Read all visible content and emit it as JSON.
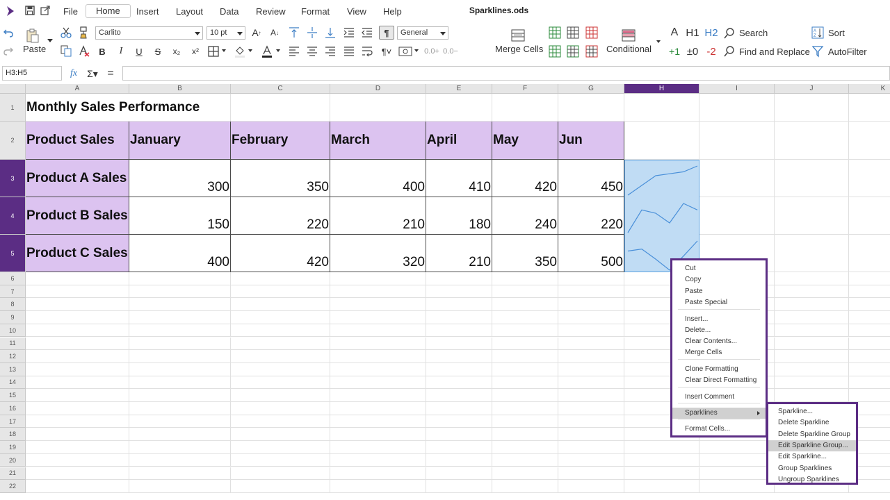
{
  "document": {
    "title": "Sparklines.ods"
  },
  "menubar": {
    "items": [
      "File",
      "Home",
      "Insert",
      "Layout",
      "Data",
      "Review",
      "Format",
      "View",
      "Help"
    ],
    "active": "Home"
  },
  "ribbon": {
    "paste_label": "Paste",
    "font_name": "Carlito",
    "font_size": "10 pt",
    "number_format": "General",
    "merge_cells_label": "Merge Cells",
    "conditional_label": "Conditional",
    "search_label": "Search",
    "find_replace_label": "Find and Replace",
    "sort_label": "Sort",
    "autofilter_label": "AutoFilter",
    "bold": "B",
    "italic": "I",
    "underline": "U",
    "strike": "S",
    "subscript": "x₂",
    "superscript": "x²",
    "heading_a": "A",
    "heading_h1": "H1",
    "heading_h2": "H2",
    "inc_1": "+1",
    "inc_0": "±0",
    "dec_2": "-2",
    "add_decimal": "0.0+",
    "del_decimal": "0.0−"
  },
  "formulabar": {
    "namebox": "H3:H5",
    "formula": ""
  },
  "sheet": {
    "columns": [
      "A",
      "B",
      "C",
      "D",
      "E",
      "F",
      "G",
      "H",
      "I",
      "J",
      "K"
    ],
    "selected_column": "H",
    "rows": [
      "1",
      "2",
      "3",
      "4",
      "5",
      "6",
      "7",
      "8",
      "9",
      "10",
      "11",
      "12",
      "13",
      "14",
      "15",
      "16",
      "17",
      "18",
      "19",
      "20",
      "21",
      "22"
    ],
    "selected_rows": [
      "3",
      "4",
      "5"
    ],
    "title": "Monthly Sales Performance",
    "header_row": [
      "Product Sales",
      "January",
      "February",
      "March",
      "April",
      "May",
      "Jun"
    ],
    "data_rows": [
      {
        "label": "Product A Sales",
        "values": [
          "300",
          "350",
          "400",
          "410",
          "420",
          "450"
        ]
      },
      {
        "label": "Product B Sales",
        "values": [
          "150",
          "220",
          "210",
          "180",
          "240",
          "220"
        ]
      },
      {
        "label": "Product C Sales",
        "values": [
          "400",
          "420",
          "320",
          "210",
          "350",
          "500"
        ]
      }
    ],
    "colors": {
      "header_fill": "#dcc3f0",
      "selection_fill": "#c0dcf4",
      "spark_line": "#4a90d9",
      "accent": "#5b2d84"
    }
  },
  "context_menu": {
    "items": [
      "Cut",
      "Copy",
      "Paste",
      "Paste Special",
      "Insert...",
      "Delete...",
      "Clear Contents...",
      "Merge Cells",
      "Clone Formatting",
      "Clear Direct Formatting",
      "Insert Comment",
      "Sparklines",
      "Format Cells..."
    ],
    "highlighted": "Sparklines"
  },
  "submenu": {
    "items": [
      "Sparkline...",
      "Delete Sparkline",
      "Delete Sparkline Group",
      "Edit Sparkline Group...",
      "Edit Sparkline...",
      "Group Sparklines",
      "Ungroup Sparklines"
    ],
    "highlighted": "Edit Sparkline Group..."
  }
}
